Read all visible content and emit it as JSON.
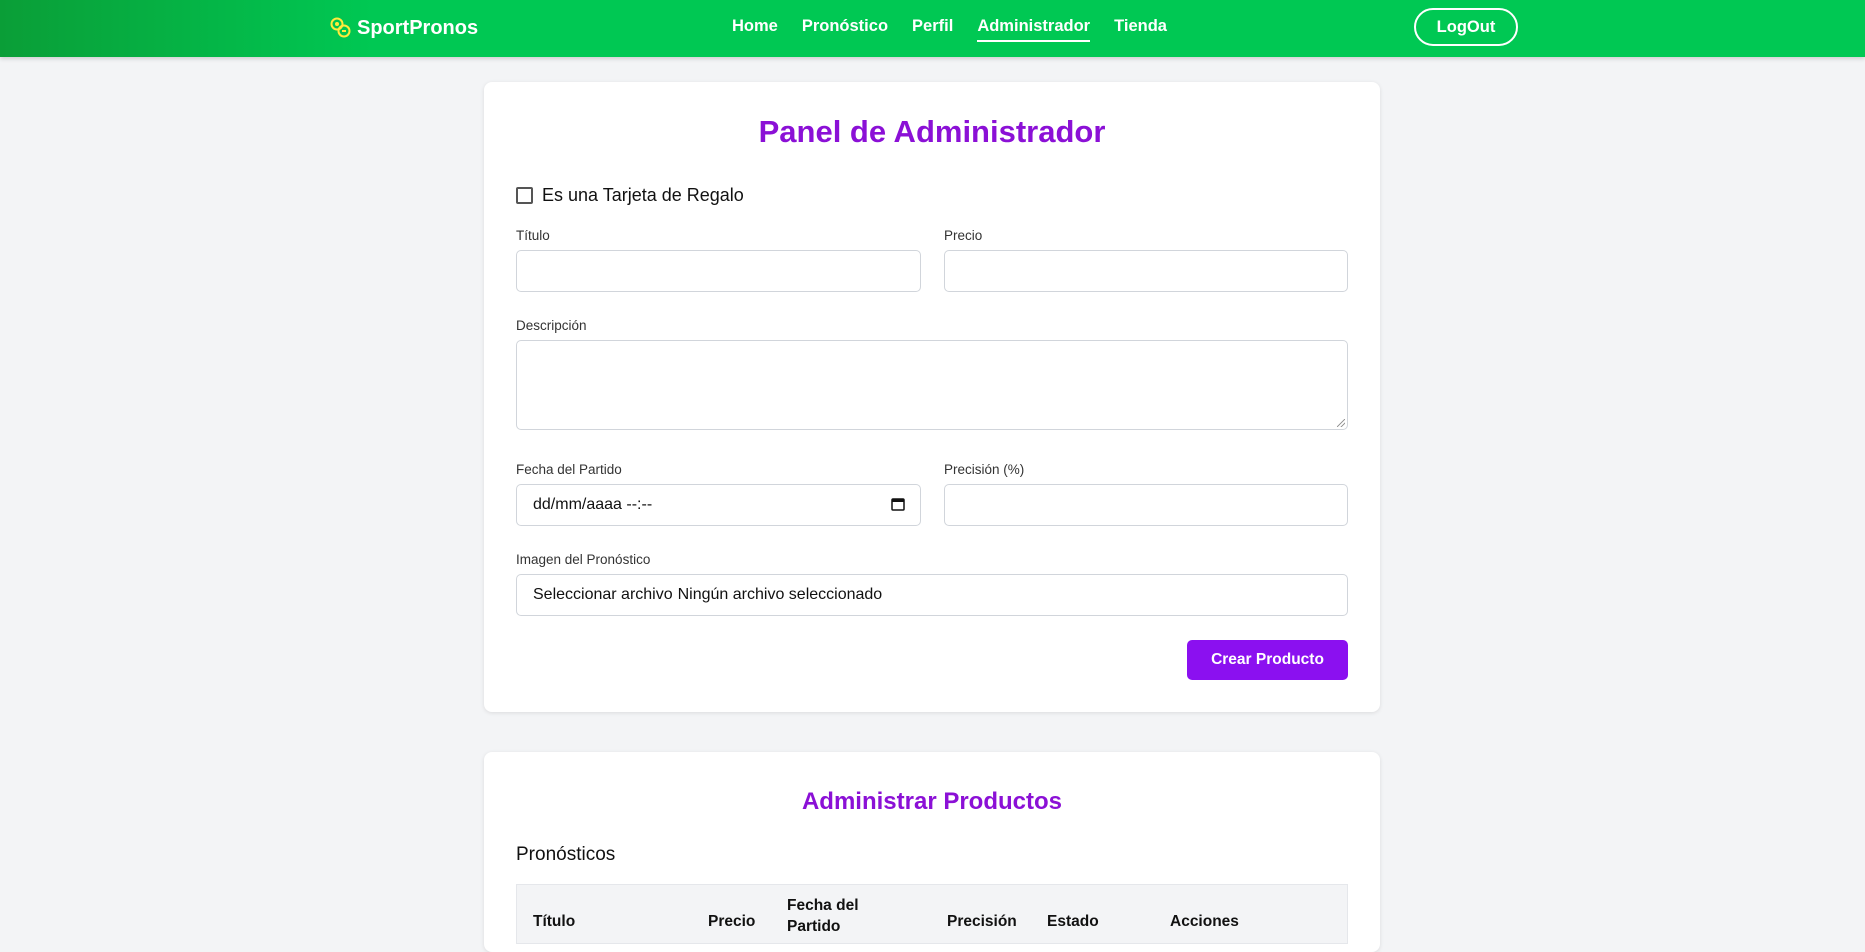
{
  "navbar": {
    "brand": "SportPronos",
    "links": [
      "Home",
      "Pronóstico",
      "Perfil",
      "Administrador",
      "Tienda"
    ],
    "active_link": "Administrador",
    "logout_label": "LogOut"
  },
  "admin_panel": {
    "title": "Panel de Administrador",
    "gift_card_label": "Es una Tarjeta de Regalo",
    "gift_card_checked": false,
    "titulo_label": "Título",
    "titulo_value": "",
    "precio_label": "Precio",
    "precio_value": "",
    "descripcion_label": "Descripción",
    "descripcion_value": "",
    "fecha_label": "Fecha del Partido",
    "fecha_value": "dd/mm/aaaa --:--",
    "precision_label": "Precisión (%)",
    "precision_value": "",
    "imagen_label": "Imagen del Pronóstico",
    "file_button": "Seleccionar archivo",
    "file_status": "Ningún archivo seleccionado",
    "submit_label": "Crear Producto"
  },
  "products_panel": {
    "title": "Administrar Productos",
    "subtitle": "Pronósticos",
    "table_headers": [
      "Título",
      "Precio",
      "Fecha del Partido",
      "Precisión",
      "Estado",
      "Acciones"
    ]
  },
  "colors": {
    "nav_green": "#00c853",
    "accent_purple": "#8b10d6",
    "button_purple": "#8b10f0",
    "page_bg": "#f3f4f6"
  }
}
